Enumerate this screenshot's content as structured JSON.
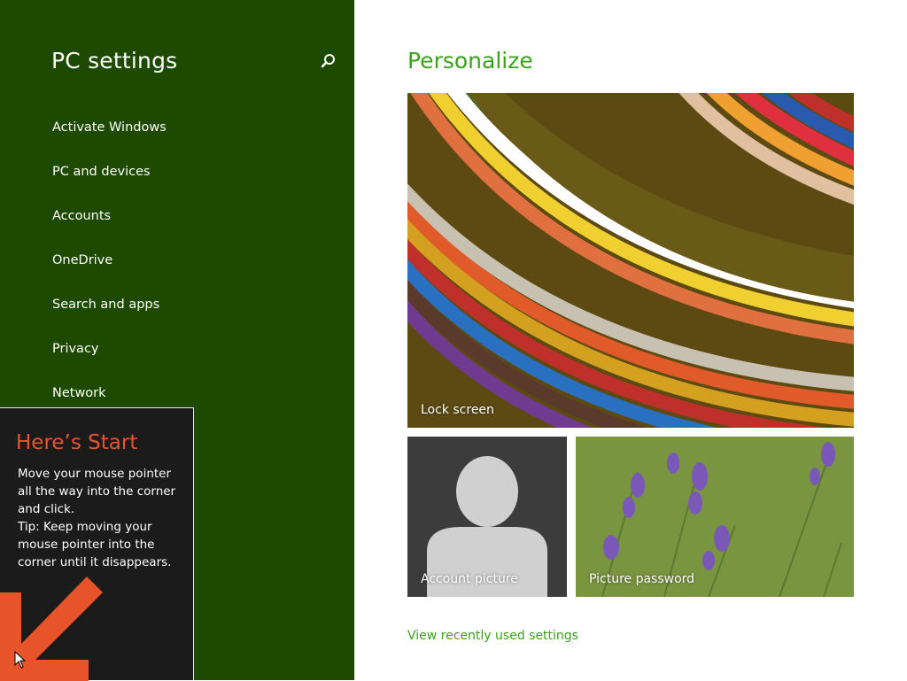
{
  "sidebar": {
    "title": "PC settings",
    "search_icon": "search-icon",
    "items": [
      {
        "label": "Activate Windows"
      },
      {
        "label": "PC and devices"
      },
      {
        "label": "Accounts"
      },
      {
        "label": "OneDrive"
      },
      {
        "label": "Search and apps"
      },
      {
        "label": "Privacy"
      },
      {
        "label": "Network"
      }
    ]
  },
  "main": {
    "title": "Personalize",
    "tiles": {
      "lock_screen": "Lock screen",
      "account_picture": "Account picture",
      "picture_password": "Picture password"
    },
    "link": "View recently used settings"
  },
  "tip": {
    "title": "Here’s Start",
    "body": "Move your mouse pointer\nall the way into the corner\nand click.\nTip: Keep moving your\nmouse pointer into the\ncorner until it disappears."
  },
  "colors": {
    "sidebar_bg": "#1e4a00",
    "accent_green": "#3aa31a",
    "tip_accent": "#e8542a"
  }
}
